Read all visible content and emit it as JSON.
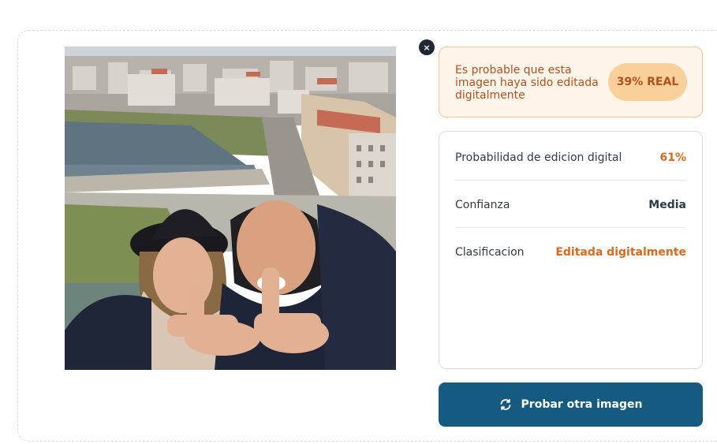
{
  "close_button": {
    "label": "×",
    "icon": "close-icon"
  },
  "result": {
    "message": "Es probable que esta imagen haya sido editada digitalmente",
    "badge": "39% REAL"
  },
  "details": [
    {
      "label": "Probabilidad de edicion digital",
      "value": "61%",
      "color": "#d96a1e"
    },
    {
      "label": "Confianza",
      "value": "Media",
      "color": "#2f3b47"
    },
    {
      "label": "Clasificacion",
      "value": "Editada digitalmente",
      "color": "#d96a1e"
    }
  ],
  "actions": {
    "retry_label": "Probar otra imagen",
    "retry_icon": "refresh-icon"
  },
  "colors": {
    "accent": "#155a80",
    "warning": "#d96a1e",
    "warning_bg": "#fef5ea"
  }
}
